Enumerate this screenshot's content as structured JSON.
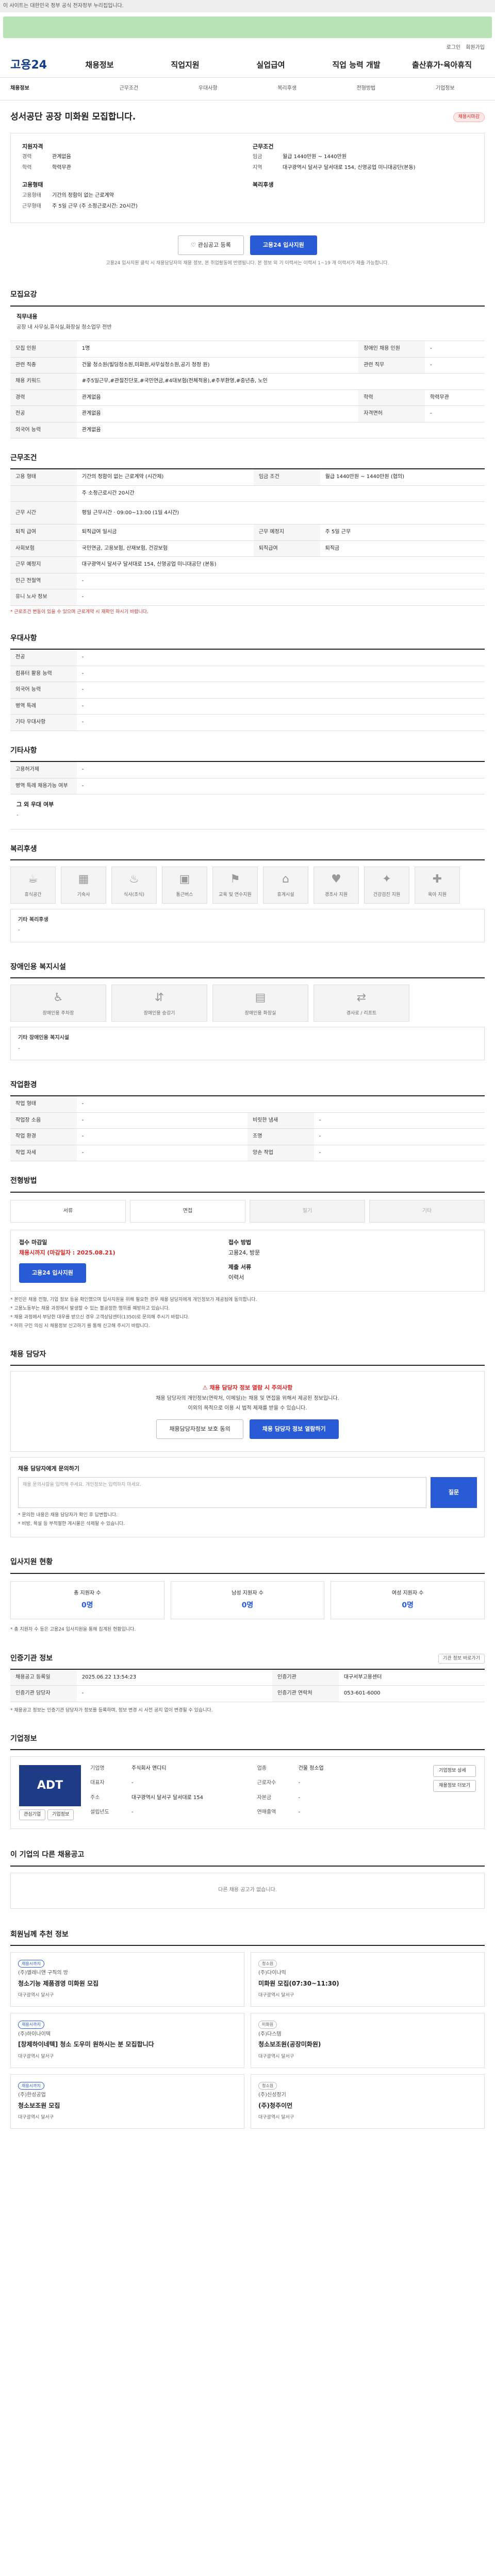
{
  "topbar": {
    "text": "이 사이트는 대한민국 정부 공식 전자정부 누리집입니다."
  },
  "util": {
    "links": [
      "로그인",
      "회원가입"
    ]
  },
  "header": {
    "logo": "고용24",
    "nav": [
      "채용정보",
      "직업지원",
      "실업급여",
      "직업 능력 개발",
      "출산휴가·육아휴직"
    ]
  },
  "subnav": [
    "채용정보",
    "근무조건",
    "우대사항",
    "복리후생",
    "전형방법",
    "기업정보"
  ],
  "job": {
    "title": "성서공단 공장 미화원 모집합니다.",
    "badge": "채용시마감"
  },
  "summary": {
    "left_title": "지원자격",
    "left_rows": [
      {
        "k": "경력",
        "v": "관계없음"
      },
      {
        "k": "학력",
        "v": "학력무관"
      }
    ],
    "left_title2": "고용형태",
    "left_rows2": [
      {
        "k": "고용형태",
        "v": "기간의 정함이 없는 근로계약"
      },
      {
        "k": "근무형태",
        "v": "주 5일 근무 (주 소정근로시간: 20시간)"
      }
    ],
    "right_title": "근무조건",
    "right_rows": [
      {
        "k": "임금",
        "v": "월급 1440만원 ~ 1440만원"
      },
      {
        "k": "지역",
        "v": "대구광역시 달서구 달서대로 154, 신영공업 미니대공단(본동)"
      }
    ],
    "right_title2": "복리후생",
    "right_rows2": [
      {
        "k": "",
        "v": ""
      }
    ]
  },
  "buttons": {
    "scrap": "관심공고 등록",
    "apply": "고용24 입사지원"
  },
  "notice": "고용24 입사지원 클릭 시 채용담당자의 채용 정보, 본 취업활동에 반영됩니다. 본 정보 외 기 이력서는 이력서 1~19 개 이력서가 제출 가능합니다.",
  "recruit": {
    "heading": "모집요강",
    "duty_h": "직무내용",
    "duty_t": "공장 내 사무실,휴식실,화장실 청소업무 전반",
    "rows": [
      [
        "모집 인원",
        "1명",
        "장애인 채용 인원",
        "-"
      ],
      [
        "관련 직종",
        "건물 청소원(빌딩청소원,미화원,사무실청소원,공기 청정 원)",
        "관련 직무",
        "-"
      ],
      [
        "채용 키워드",
        "#주5일근무,#관절진단포,#국민연금,#4대보험(전체적용),#주부환영,#중년층, 노인",
        "",
        ""
      ],
      [
        "경력",
        "관계없음",
        "학력",
        "학력무관"
      ],
      [
        "전공",
        "관계없음",
        "자격면허",
        "-"
      ],
      [
        "외국어 능력",
        "관계없음",
        "",
        ""
      ]
    ]
  },
  "conditions": {
    "heading": "근무조건",
    "rows": [
      [
        "고용 형태",
        "기간의 정함이 없는 근로계약 (시간제)",
        "임금 조건",
        "월급 1440만원 ~ 1440만원 (협의)"
      ],
      [
        "",
        "주 소정근로시간 20시간",
        "",
        ""
      ],
      [
        "근무 시간",
        "평일 근무시간 · 09:00~13:00 (1일 4시간)",
        "",
        ""
      ],
      [
        "퇴직 급여",
        "퇴직급여 일시금",
        "근무 예정지",
        "주 5일 근무"
      ],
      [
        "사회보험",
        "국민연금, 고용보험, 산재보험, 건강보험",
        "퇴직급여",
        "퇴직금"
      ],
      [
        "근무 예정지",
        "대구광역시 달서구 달서대로 154, 신영공업 미니대공단 (본동)",
        "",
        ""
      ],
      [
        "인근 전철역",
        "-",
        "",
        ""
      ],
      [
        "유니 노사 정보",
        "-",
        "",
        ""
      ]
    ],
    "note": "* 근로조건 변동이 있을 수 있으며 근로계약 시 재확인 하시기 바랍니다."
  },
  "prefer": {
    "heading": "우대사항",
    "rows": [
      [
        "전공",
        "-"
      ],
      [
        "컴퓨터 활용 능력",
        "-"
      ],
      [
        "외국어 능력",
        "-"
      ],
      [
        "병역 특례",
        "-"
      ],
      [
        "기타 우대사항",
        "-"
      ]
    ]
  },
  "etc": {
    "heading": "기타사항",
    "rows": [
      [
        "고용허가제",
        "-"
      ],
      [
        "병역 특례 채용가능 여부",
        "-"
      ]
    ],
    "extra_h": "그 외 우대 여부",
    "extra_t": "-"
  },
  "benefits": {
    "heading": "복리후생",
    "icons": [
      {
        "g": "☕",
        "t": "휴식공간"
      },
      {
        "g": "▦",
        "t": "기숙사"
      },
      {
        "g": "♨",
        "t": "식사(조식)"
      },
      {
        "g": "▣",
        "t": "통근버스"
      },
      {
        "g": "⚑",
        "t": "교육 및 연수지원"
      },
      {
        "g": "⌂",
        "t": "휴게시설"
      },
      {
        "g": "♥",
        "t": "경조사 지원"
      },
      {
        "g": "✦",
        "t": "건강검진 지원"
      },
      {
        "g": "✚",
        "t": "육아 지원"
      }
    ],
    "free_h": "기타 복리후생",
    "free_t": "-"
  },
  "disability": {
    "heading": "장애인용 복지시설",
    "icons": [
      {
        "g": "♿",
        "t": "장애인용 주차장"
      },
      {
        "g": "⇵",
        "t": "장애인용 승강기"
      },
      {
        "g": "▤",
        "t": "장애인용 화장실"
      },
      {
        "g": "⇄",
        "t": "경사로 / 리프트"
      }
    ],
    "free_h": "기타 장애인용 복지시설",
    "free_t": "-"
  },
  "workenv": {
    "heading": "작업환경",
    "rows": [
      [
        "작업 형태",
        "-",
        "",
        ""
      ],
      [
        "작업장 소음",
        "-",
        "비릿한 냄새",
        "-"
      ],
      [
        "작업 환경",
        "-",
        "조명",
        "-"
      ],
      [
        "작업 자세",
        "-",
        "양손 작업",
        "-"
      ]
    ]
  },
  "selection": {
    "heading": "전형방법",
    "steps": [
      "서류",
      "면접",
      "필기",
      "기타"
    ],
    "apply_h": "접수 마감일",
    "apply_v": "채용시까지 (마감일자 : 2025.08.21)",
    "apply_btn": "고용24 입사지원",
    "method_h": "제출 서류",
    "method_v": "이력서",
    "way_h": "접수 방법",
    "way_v": "고용24, 방문",
    "bullets": [
      "* 본인은 채용 전형, 기업 정보 등을 확인했으며 입사지원을 위해 필요한 경우 채용 담당자에게 개인정보가 제공됨에 동의합니다.",
      "* 고용노동부는 채용 과정에서 발생할 수 있는 불공정한 행위를 예방하고 있습니다.",
      "* 채용 과정에서 부당한 대우를 받으신 경우 고객상담센터(1350)로 문의해 주시기 바랍니다.",
      "* 허위 구인 의심 시 채용정보 신고하기 를 통해 신고해 주시기 바랍니다."
    ]
  },
  "contact": {
    "heading": "채용 담당자",
    "t1": "채용 담당자 정보 열람 시 주의사항",
    "t2": "채용 담당자의 개인정보(연락처, 이메일)는 채용 및 면접을 위해서 제공된 정보입니다.",
    "t3": "이외의 목적으로 이용 시 법적 제재를 받을 수 있습니다.",
    "b1": "채용담당자정보 보호 동의",
    "b2": "채용 담당자 정보 열람하기"
  },
  "question": {
    "heading": "채용 담당자에게 문의하기",
    "placeholder": "채용 문의사항을 입력해 주세요. 개인정보는 입력하지 마세요.",
    "btn": "질문",
    "notes": [
      "* 문의한 내용은 채용 담당자가 확인 후 답변합니다.",
      "* 비방, 욕설 등 부적절한 게시물은 삭제될 수 있습니다."
    ]
  },
  "status": {
    "heading": "입사지원 현황",
    "items": [
      {
        "t": "총 지원자 수",
        "n": "0명"
      },
      {
        "t": "남성 지원자 수",
        "n": "0명"
      },
      {
        "t": "여성 지원자 수",
        "n": "0명"
      }
    ],
    "note": "* 총 지원자 수 등은 고용24 입사지원을 통해 집계된 현황입니다."
  },
  "agency": {
    "heading": "인증기관 정보",
    "link": "기관 정보 바로가기",
    "rows": [
      [
        "채용공고 등록일",
        "2025.06.22 13:54:23",
        "인증기관",
        "대구서부고용센터"
      ],
      [
        "인증기관 담당자",
        "-",
        "인증기관 연락처",
        "053-601-6000"
      ]
    ],
    "note": "* 채용공고 정보는 인증기관 담당자가 정보를 등록하며, 정보 변경 시 사전 공지 없이 변경될 수 있습니다."
  },
  "company": {
    "heading": "기업정보",
    "logo": "ADT",
    "btns": [
      "관심기업",
      "기업정보"
    ],
    "rows": [
      [
        "기업명",
        "주식회사 앤디티",
        "업종",
        "건물 청소업"
      ],
      [
        "대표자",
        "-",
        "근로자수",
        "-"
      ],
      [
        "주소",
        "대구광역시 달서구 달서대로 154",
        "자본금",
        "-"
      ],
      [
        "설립년도",
        "-",
        "연매출액",
        "-"
      ]
    ],
    "side_btns": [
      "기업정보 상세",
      "채용정보 더보기"
    ]
  },
  "others": {
    "heading": "이 기업의 다른 채용공고",
    "empty": "다른 채용 공고가 없습니다."
  },
  "recommend": {
    "heading": "회원님께 추천 정보",
    "cards": [
      {
        "tag": "채용시까지",
        "co": "(주)엘레니앤 구직의 방",
        "title": "청소기능 제품경영 미화원 모집",
        "meta": "대구광역시 달서구"
      },
      {
        "tag": "청소원",
        "co": "(주)다이나믹",
        "title": "미화원 모집(07:30~11:30)",
        "meta": "대구광역시 달서구"
      },
      {
        "tag": "채용시까지",
        "co": "(주)하이나이텍",
        "title": "[창제하이네텍] 청소 도우미 원하시는 분 모집합니다",
        "meta": "대구광역시 달서구"
      },
      {
        "tag": "미화원",
        "co": "(주)다스템",
        "title": "청소보조원(공장미화원)",
        "meta": "대구광역시 달서구"
      },
      {
        "tag": "채용시까지",
        "co": "(주)한성공업",
        "title": "청소보조원 모집",
        "meta": "대구광역시 달서구"
      },
      {
        "tag": "청소원",
        "co": "(주)신성정기",
        "title": "(주)청주이먼",
        "meta": "대구광역시 달서구"
      }
    ]
  }
}
